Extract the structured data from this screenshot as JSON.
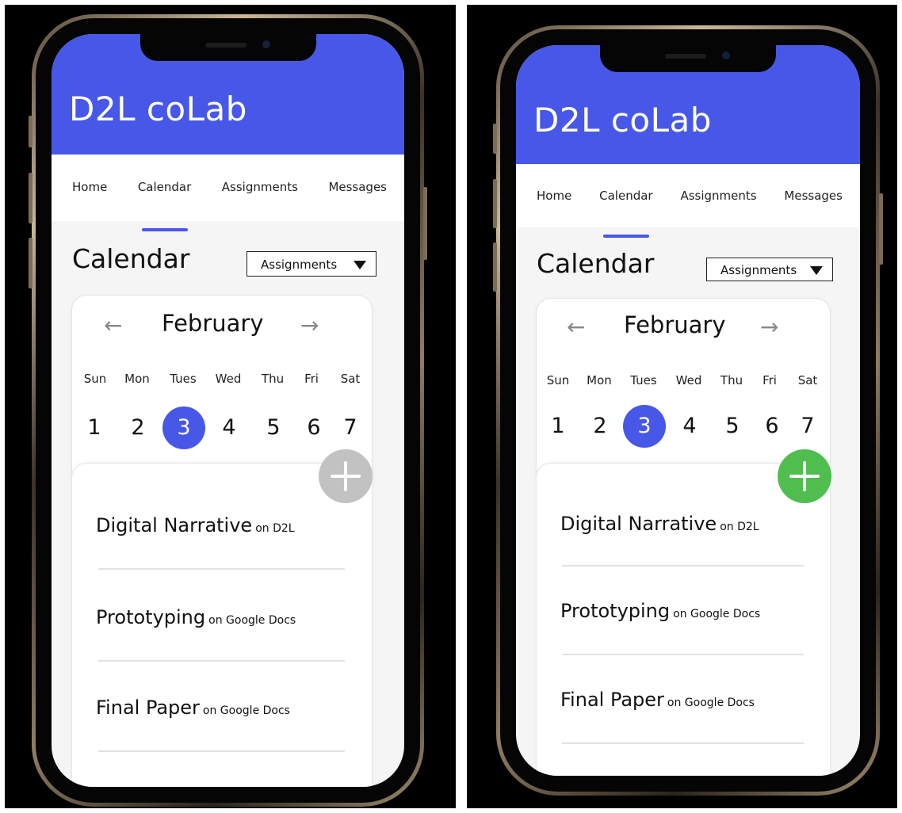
{
  "colors": {
    "accent": "#4758e8",
    "fab_left": "#c2c2c2",
    "fab_right": "#4fbe4f"
  },
  "screens": [
    {
      "app_title": "D2L coLab",
      "nav": [
        "Home",
        "Calendar",
        "Assignments",
        "Messages"
      ],
      "active_nav": "Calendar",
      "page_title": "Calendar",
      "dropdown_value": "Assignments",
      "month": "February",
      "prev_icon": "arrow-left-icon",
      "next_icon": "arrow-right-icon",
      "weekdays": [
        "Sun",
        "Mon",
        "Tues",
        "Wed",
        "Thu",
        "Fri",
        "Sat"
      ],
      "dates": [
        "1",
        "2",
        "3",
        "4",
        "5",
        "6",
        "7"
      ],
      "selected_date": "3",
      "fab_icon": "plus-icon",
      "fab_state": "disabled",
      "assignments": [
        {
          "name": "Digital Narrative",
          "where": "on D2L"
        },
        {
          "name": "Prototyping",
          "where": "on Google Docs"
        },
        {
          "name": "Final Paper",
          "where": "on Google Docs"
        }
      ]
    },
    {
      "app_title": "D2L coLab",
      "nav": [
        "Home",
        "Calendar",
        "Assignments",
        "Messages"
      ],
      "active_nav": "Calendar",
      "page_title": "Calendar",
      "dropdown_value": "Assignments",
      "month": "February",
      "prev_icon": "arrow-left-icon",
      "next_icon": "arrow-right-icon",
      "weekdays": [
        "Sun",
        "Mon",
        "Tues",
        "Wed",
        "Thu",
        "Fri",
        "Sat"
      ],
      "dates": [
        "1",
        "2",
        "3",
        "4",
        "5",
        "6",
        "7"
      ],
      "selected_date": "3",
      "fab_icon": "plus-icon",
      "fab_state": "active",
      "assignments": [
        {
          "name": "Digital Narrative",
          "where": "on D2L"
        },
        {
          "name": "Prototyping",
          "where": "on Google Docs"
        },
        {
          "name": "Final Paper",
          "where": "on Google Docs"
        }
      ]
    }
  ]
}
